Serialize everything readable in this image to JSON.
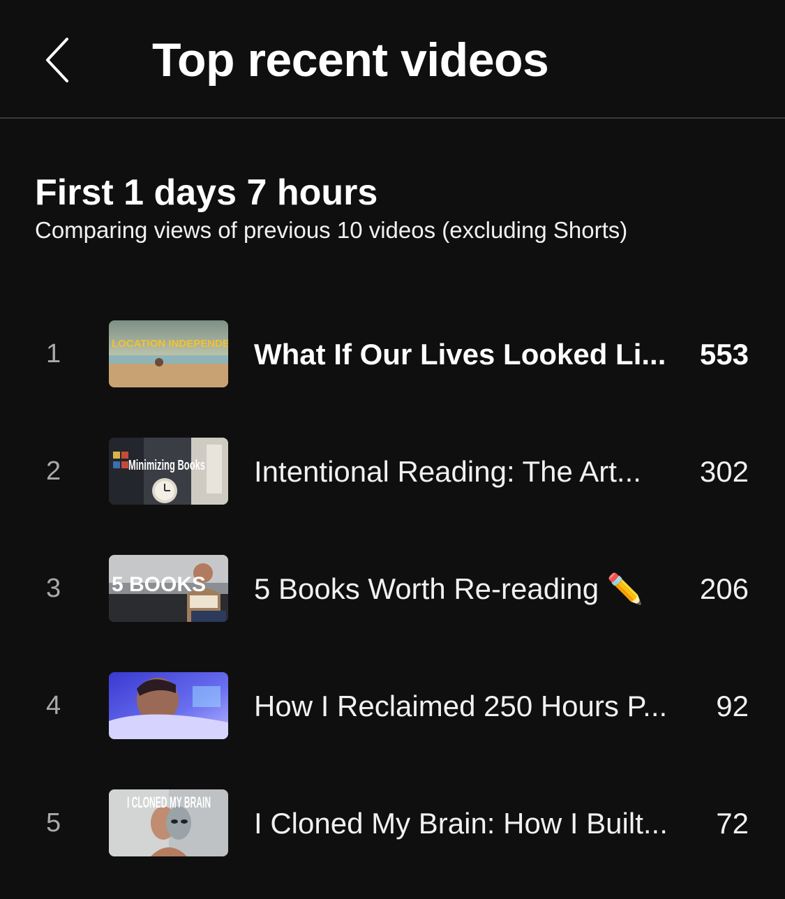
{
  "header": {
    "title": "Top recent videos",
    "back_icon": "chevron-left-icon"
  },
  "section": {
    "title": "First 1 days 7 hours",
    "subtitle": "Comparing views of previous 10 videos (excluding Shorts)"
  },
  "videos": [
    {
      "rank": "1",
      "title": "What If Our Lives Looked Li...",
      "views": "553",
      "thumb_text": "LOCATION INDEPENDENCE"
    },
    {
      "rank": "2",
      "title": "Intentional Reading: The Art...",
      "views": "302",
      "thumb_text": "Minimizing Books"
    },
    {
      "rank": "3",
      "title": "5 Books Worth Re-reading ✏️",
      "views": "206",
      "thumb_text": "5 BOOKS"
    },
    {
      "rank": "4",
      "title": "How I Reclaimed 250 Hours P...",
      "views": "92",
      "thumb_text": ""
    },
    {
      "rank": "5",
      "title": "I Cloned My Brain: How I Built...",
      "views": "72",
      "thumb_text": "I CLONED MY BRAIN"
    }
  ],
  "colors": {
    "background": "#0f0f0f",
    "divider": "#3a3a3a",
    "rank": "#aaaaaa"
  }
}
